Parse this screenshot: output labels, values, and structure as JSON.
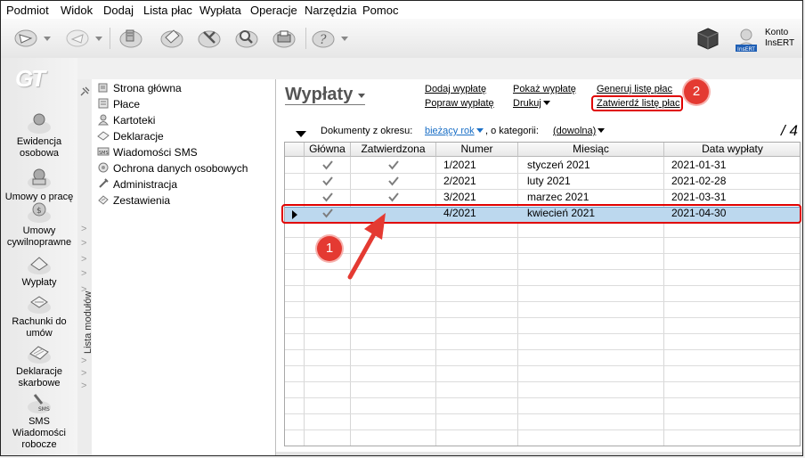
{
  "menu": [
    "Podmiot",
    "Widok",
    "Dodaj",
    "Lista płac",
    "Wypłata",
    "Operacje",
    "Narzędzia",
    "Pomoc"
  ],
  "toolbar": {
    "icons": [
      "send-icon",
      "receive-icon",
      "payment-icon",
      "document-icon",
      "tools-icon",
      "search-icon",
      "printer-icon",
      "help-icon"
    ],
    "account_line1": "Konto",
    "account_line2": "InsERT",
    "account_brand": "InsERT"
  },
  "leftnav": {
    "logo": "GT",
    "items": [
      {
        "label": "Ewidencja osobowa",
        "icon": "people-icon"
      },
      {
        "label": "Umowy o pracę",
        "icon": "contract-icon"
      },
      {
        "label": "Umowy cywilnoprawne",
        "icon": "civil-contract-icon"
      },
      {
        "label": "Wypłaty",
        "icon": "payout-icon"
      },
      {
        "label": "Rachunki do umów",
        "icon": "invoice-icon"
      },
      {
        "label": "Deklaracje skarbowe",
        "icon": "tax-declaration-icon"
      },
      {
        "label": "SMS Wiadomości robocze",
        "icon": "sms-icon"
      }
    ]
  },
  "module_list_label": "Lista modułów",
  "tree": {
    "items": [
      {
        "label": "Strona główna",
        "icon": "home-icon"
      },
      {
        "label": "Płace",
        "icon": "payroll-icon"
      },
      {
        "label": "Kartoteki",
        "icon": "records-icon"
      },
      {
        "label": "Deklaracje",
        "icon": "declaration-icon"
      },
      {
        "label": "Wiadomości SMS",
        "icon": "sms-icon"
      },
      {
        "label": "Ochrona danych osobowych",
        "icon": "shield-icon"
      },
      {
        "label": "Administracja",
        "icon": "admin-icon"
      },
      {
        "label": "Zestawienia",
        "icon": "report-icon"
      }
    ]
  },
  "page": {
    "title": "Wypłaty",
    "actions": {
      "add": "Dodaj wypłatę",
      "fix": "Popraw wypłatę",
      "show": "Pokaż wypłatę",
      "print": "Drukuj",
      "generate": "Generuj listę płac",
      "approve": "Zatwierdź listę płac"
    },
    "filter": {
      "period_label": "Dokumenty z okresu:",
      "period_value": "bieżący rok",
      "category_label": ", o kategorii:",
      "category_value": "(dowolna)"
    },
    "count": "/ 4"
  },
  "grid": {
    "columns": [
      "Główna",
      "Zatwierdzona",
      "Numer",
      "Miesiąc",
      "Data wypłaty"
    ],
    "rows": [
      {
        "glowna": true,
        "zatwierdzona": true,
        "numer": "1/2021",
        "miesiac": "styczeń 2021",
        "data": "2021-01-31"
      },
      {
        "glowna": true,
        "zatwierdzona": true,
        "numer": "2/2021",
        "miesiac": "luty 2021",
        "data": "2021-02-28"
      },
      {
        "glowna": true,
        "zatwierdzona": true,
        "numer": "3/2021",
        "miesiac": "marzec 2021",
        "data": "2021-03-31"
      },
      {
        "glowna": true,
        "zatwierdzona": false,
        "numer": "4/2021",
        "miesiac": "kwiecień 2021",
        "data": "2021-04-30"
      }
    ],
    "selected_row": 3
  },
  "annotations": {
    "badge1": "1",
    "badge2": "2",
    "color": "#e43a32"
  }
}
